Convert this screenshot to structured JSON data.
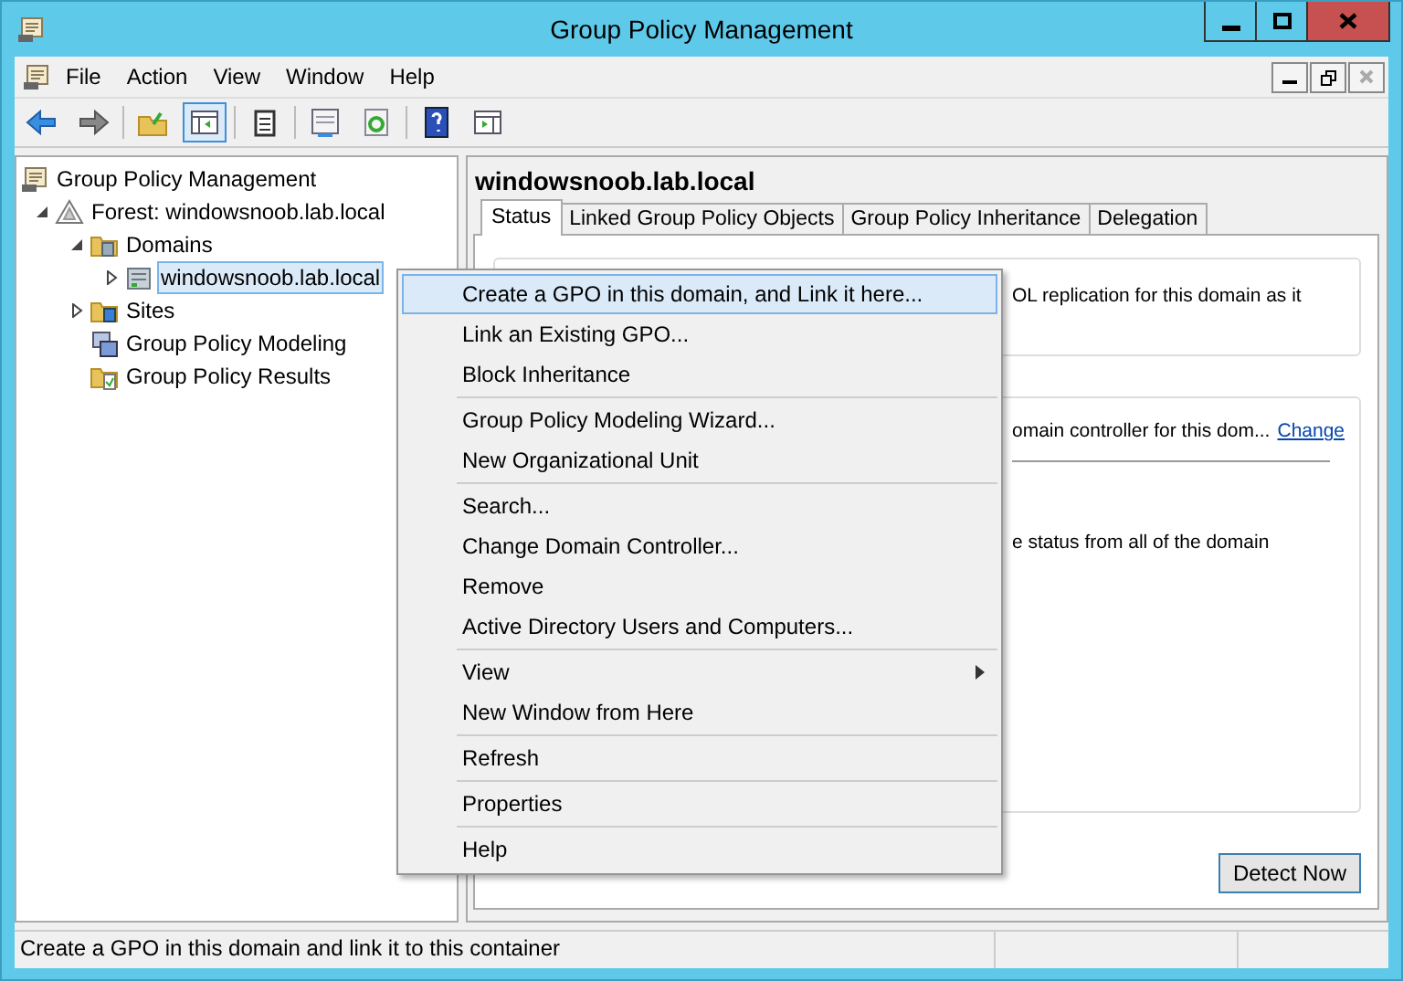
{
  "window": {
    "title": "Group Policy Management"
  },
  "menu_bar": [
    "File",
    "Action",
    "View",
    "Window",
    "Help"
  ],
  "toolbar": [
    {
      "kind": "back",
      "selected": false
    },
    {
      "kind": "forward",
      "selected": false
    },
    {
      "kind": "up",
      "selected": false
    },
    {
      "kind": "console-tree",
      "selected": true
    },
    {
      "kind": "clipboard",
      "selected": false
    },
    {
      "kind": "properties",
      "selected": false
    },
    {
      "kind": "refresh",
      "selected": false
    },
    {
      "kind": "help",
      "selected": false
    },
    {
      "kind": "action-pane",
      "selected": false
    }
  ],
  "tree": [
    {
      "label": "Group Policy Management",
      "kind": "root",
      "selected": false,
      "children": [
        {
          "label": "Forest: windowsnoob.lab.local",
          "kind": "forest",
          "expanded": true,
          "selected": false,
          "children": [
            {
              "label": "Domains",
              "kind": "domains",
              "expanded": true,
              "selected": false,
              "children": [
                {
                  "label": "windowsnoob.lab.local",
                  "kind": "domain",
                  "expanded": false,
                  "selected": true
                }
              ]
            },
            {
              "label": "Sites",
              "kind": "sites",
              "expanded": false,
              "selected": false
            },
            {
              "label": "Group Policy Modeling",
              "kind": "modeling",
              "selected": false
            },
            {
              "label": "Group Policy Results",
              "kind": "results",
              "selected": false
            }
          ]
        }
      ]
    }
  ],
  "details": {
    "heading": "windowsnoob.lab.local",
    "tabs": [
      {
        "label": "Status",
        "selected": true
      },
      {
        "label": "Linked Group Policy Objects",
        "selected": false
      },
      {
        "label": "Group Policy Inheritance",
        "selected": false
      },
      {
        "label": "Delegation",
        "selected": false
      }
    ],
    "box_1_text": "OL replication for this domain as it",
    "box_2_text": "omain controller for this dom...",
    "box_2_link": "Change",
    "box_2_text_2": "e status from all of the domain",
    "button": "Detect Now"
  },
  "context_menu": [
    {
      "kind": "item",
      "label": "Create a GPO in this domain, and Link it here...",
      "selected": true,
      "submenu": false
    },
    {
      "kind": "item",
      "label": "Link an Existing GPO...",
      "selected": false,
      "submenu": false
    },
    {
      "kind": "item",
      "label": "Block Inheritance",
      "selected": false,
      "submenu": false
    },
    {
      "kind": "separator"
    },
    {
      "kind": "item",
      "label": "Group Policy Modeling Wizard...",
      "selected": false,
      "submenu": false
    },
    {
      "kind": "item",
      "label": "New Organizational Unit",
      "selected": false,
      "submenu": false
    },
    {
      "kind": "separator"
    },
    {
      "kind": "item",
      "label": "Search...",
      "selected": false,
      "submenu": false
    },
    {
      "kind": "item",
      "label": "Change Domain Controller...",
      "selected": false,
      "submenu": false
    },
    {
      "kind": "item",
      "label": "Remove",
      "selected": false,
      "submenu": false
    },
    {
      "kind": "item",
      "label": "Active Directory Users and Computers...",
      "selected": false,
      "submenu": false
    },
    {
      "kind": "separator"
    },
    {
      "kind": "item",
      "label": "View",
      "selected": false,
      "submenu": true
    },
    {
      "kind": "item",
      "label": "New Window from Here",
      "selected": false,
      "submenu": false
    },
    {
      "kind": "separator"
    },
    {
      "kind": "item",
      "label": "Refresh",
      "selected": false,
      "submenu": false
    },
    {
      "kind": "separator"
    },
    {
      "kind": "item",
      "label": "Properties",
      "selected": false,
      "submenu": false
    },
    {
      "kind": "separator"
    },
    {
      "kind": "item",
      "label": "Help",
      "selected": false,
      "submenu": false
    }
  ],
  "status_bar": "Create a GPO in this domain and link it to this container"
}
